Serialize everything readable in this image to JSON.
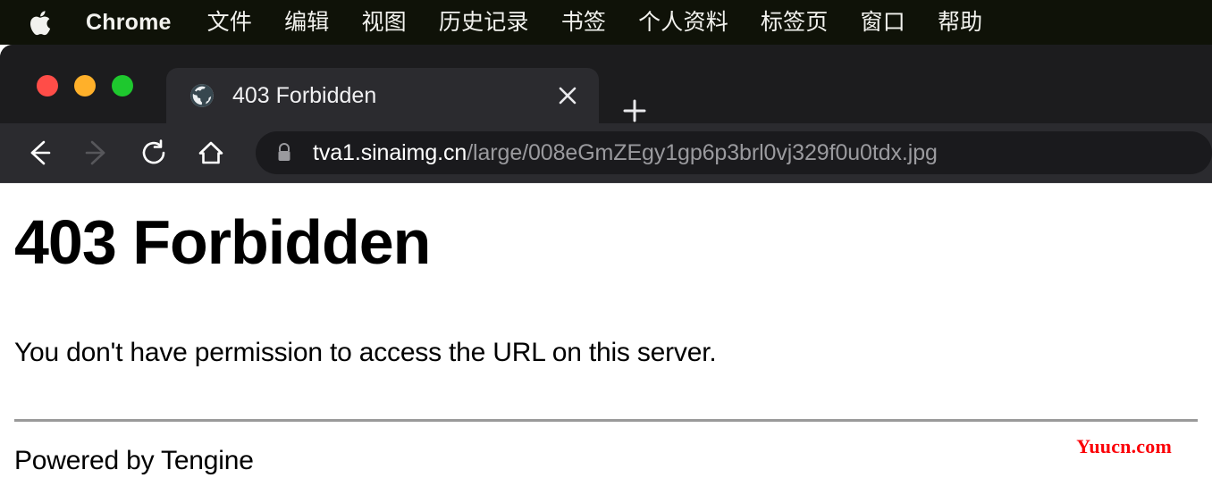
{
  "menubar": {
    "apple_icon": "apple-logo-icon",
    "items": [
      {
        "label": "Chrome",
        "bold": true
      },
      {
        "label": "文件",
        "bold": false
      },
      {
        "label": "编辑",
        "bold": false
      },
      {
        "label": "视图",
        "bold": false
      },
      {
        "label": "历史记录",
        "bold": false
      },
      {
        "label": "书签",
        "bold": false
      },
      {
        "label": "个人资料",
        "bold": false
      },
      {
        "label": "标签页",
        "bold": false
      },
      {
        "label": "窗口",
        "bold": false
      },
      {
        "label": "帮助",
        "bold": false
      }
    ],
    "background": "#0f1208",
    "text_color": "#f2f2ee"
  },
  "window_controls": {
    "close_color": "#ff4d48",
    "minimize_color": "#ffb02a",
    "maximize_color": "#1ec82e"
  },
  "tabstrip": {
    "tab": {
      "title": "403 Forbidden",
      "favicon": "globe-icon",
      "close_icon": "close-icon",
      "active": true
    },
    "new_tab_icon": "plus-icon",
    "background": "#1c1c1e",
    "active_tab_background": "#2b2b2f"
  },
  "toolbar": {
    "back_icon": "arrow-left-icon",
    "forward_icon": "arrow-right-icon",
    "reload_icon": "reload-icon",
    "home_icon": "home-icon",
    "back_enabled": true,
    "forward_enabled": false,
    "background": "#2b2b2f"
  },
  "omnibox": {
    "security_icon": "lock-icon",
    "host": "tva1.sinaimg.cn",
    "path": "/large/008eGmZEgy1gp6p3brl0vj329f0u0tdx.jpg",
    "host_color": "#ffffff",
    "path_color": "#9a9a9e",
    "background": "#1a1a1d"
  },
  "page": {
    "heading": "403 Forbidden",
    "body": "You don't have permission to access the URL on this server.",
    "footer": "Powered by Tengine",
    "background": "#ffffff",
    "text_color": "#000000",
    "rule_color": "#9a9a9a"
  },
  "watermark": {
    "text": "Yuucn.com",
    "color": "#fb0007"
  }
}
